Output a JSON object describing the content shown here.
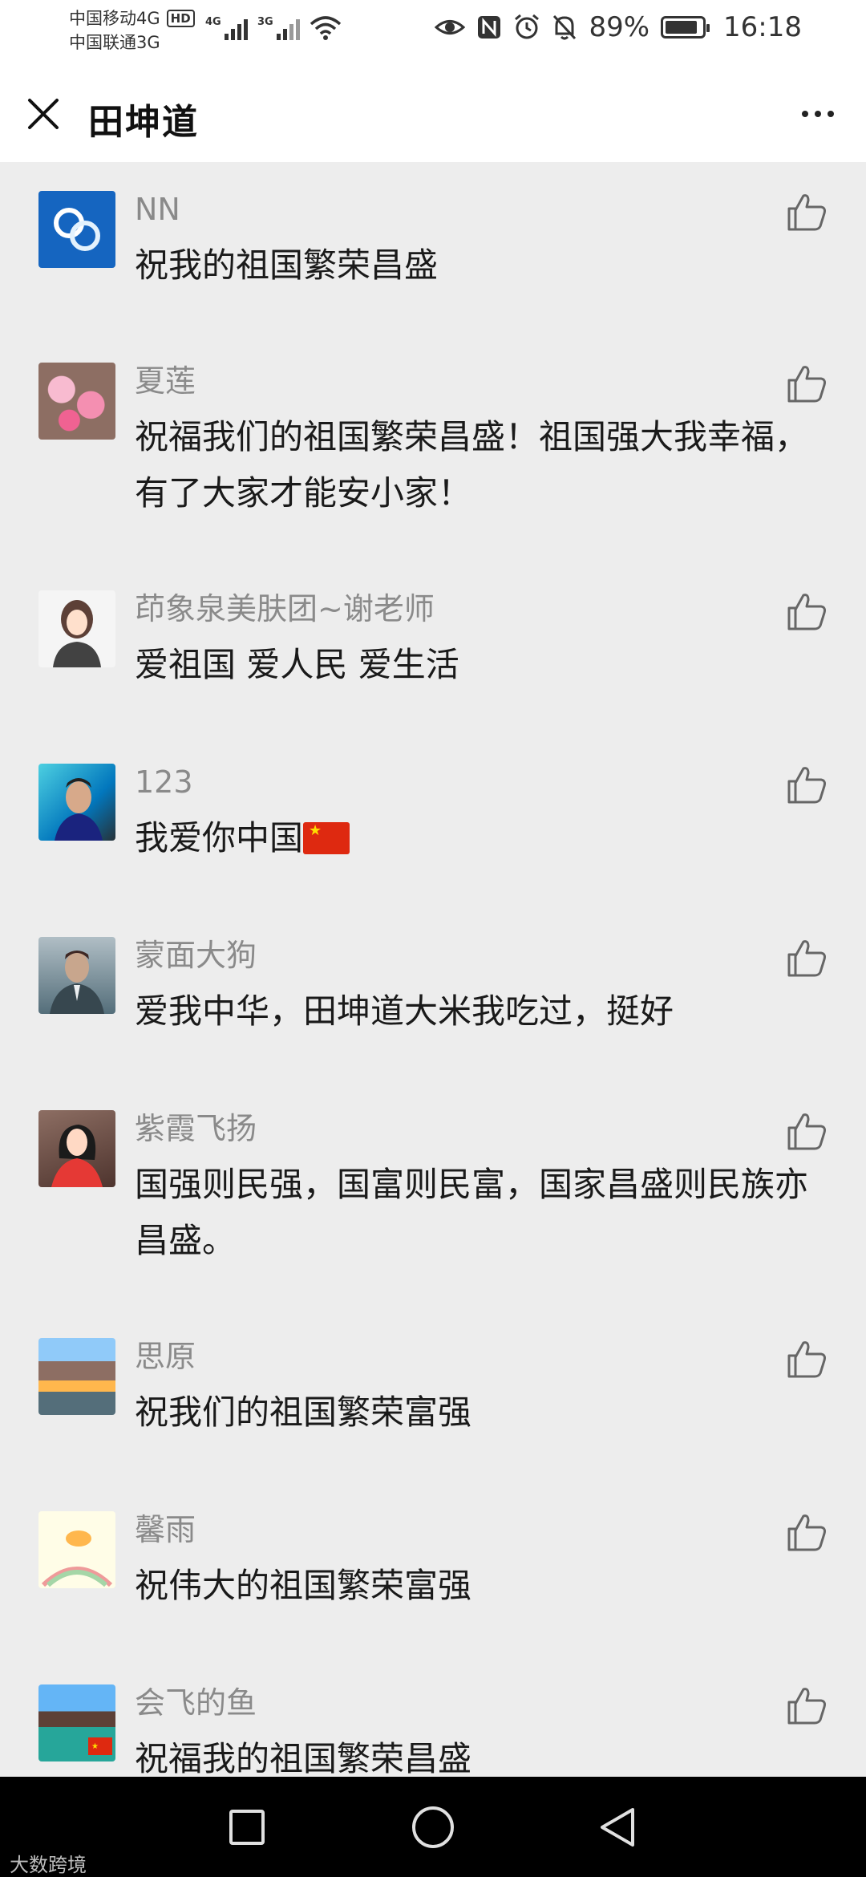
{
  "status_bar": {
    "carrier1": "中国移动4G",
    "carrier1_badge": "HD",
    "carrier2": "中国联通3G",
    "signal1_label": "4G",
    "signal2_label": "3G",
    "battery": "89%",
    "battery_level": 0.89,
    "time": "16:18"
  },
  "header": {
    "title": "田坤道"
  },
  "comments": [
    {
      "nickname": "NN",
      "text": "祝我的祖国繁荣昌盛"
    },
    {
      "nickname": "夏莲",
      "text": "祝福我们的祖国繁荣昌盛！祖国强大我幸福，有了大家才能安小家！"
    },
    {
      "nickname": "茚象泉美肤团~谢老师",
      "text": "爱祖国 爱人民 爱生活"
    },
    {
      "nickname": "123",
      "text": "我爱你中国"
    },
    {
      "nickname": "蒙面大狗",
      "text": "爱我中华，田坤道大米我吃过，挺好"
    },
    {
      "nickname": "紫霞飞扬",
      "text": "国强则民强，国富则民富，国家昌盛则民族亦昌盛。"
    },
    {
      "nickname": "思原",
      "text": "祝我们的祖国繁荣富强"
    },
    {
      "nickname": "馨雨",
      "text": "祝伟大的祖国繁荣富强"
    },
    {
      "nickname": "会飞的鱼",
      "text": "祝福我的祖国繁荣昌盛"
    }
  ],
  "watermark": "大数跨境",
  "colors": {
    "background": "#ededed",
    "nickname": "#8a8a8a",
    "text": "#1a1a1a",
    "nav_bar": "#000000"
  }
}
